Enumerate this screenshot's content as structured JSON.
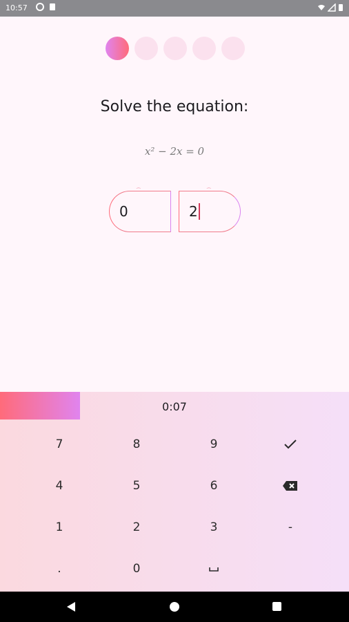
{
  "status_bar": {
    "time": "10:57",
    "icons": [
      "sync-icon",
      "sd-card-icon",
      "wifi-icon",
      "signal-icon",
      "battery-icon"
    ]
  },
  "progress": {
    "total_steps": 5,
    "current_step": 1,
    "active_color": "#e084ef",
    "inactive_color": "#fbe1ee"
  },
  "question": {
    "prompt": "Solve the equation:",
    "equation": "x² − 2x = 0"
  },
  "answers": {
    "left_value": "0",
    "right_value": "2",
    "left_hint": "⁀",
    "right_hint": "⁀"
  },
  "timer": {
    "text": "0:07",
    "fraction_remaining": 0.23,
    "colors": [
      "#ff6b7a",
      "#e084ef"
    ]
  },
  "keypad": {
    "rows": [
      [
        "7",
        "8",
        "9",
        "✓"
      ],
      [
        "4",
        "5",
        "6",
        "⌫"
      ],
      [
        "1",
        "2",
        "3",
        "-"
      ],
      [
        ".",
        "0",
        "␣",
        ""
      ]
    ]
  },
  "nav": {
    "back": "back-icon",
    "home": "home-icon",
    "recents": "recents-icon"
  }
}
